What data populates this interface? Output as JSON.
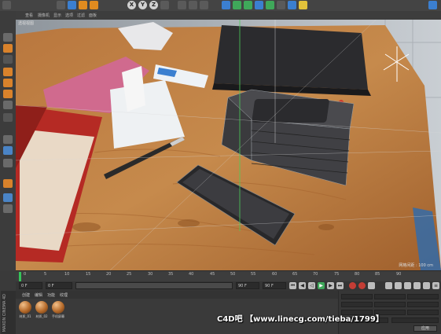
{
  "toolbar": {
    "axis_buttons": [
      "X",
      "Y",
      "Z"
    ]
  },
  "viewport": {
    "menu": [
      "查看",
      "摄像机",
      "显示",
      "选项",
      "过滤",
      "面板"
    ],
    "label": "透视视图",
    "scale": "网格间距 : 100 cm"
  },
  "timeline": {
    "ticks": [
      "0",
      "5",
      "10",
      "15",
      "20",
      "25",
      "30",
      "35",
      "40",
      "45",
      "50",
      "55",
      "60",
      "65",
      "70",
      "75",
      "80",
      "85",
      "90"
    ]
  },
  "transport": {
    "start_frame": "0 F",
    "end_frame": "90 F",
    "min_frame": "0 F",
    "max_frame": "90 F"
  },
  "material_manager": {
    "menu": [
      "创建",
      "编辑",
      "功能",
      "纹理"
    ],
    "materials": [
      "材质_01",
      "材质_02",
      "手机屏幕"
    ]
  },
  "attributes": {
    "apply_label": "应用"
  },
  "brand": "MAXON CINEMA 4D",
  "watermark": "C4D吧 【www.linecg.com/tieba/1799】",
  "colors": {
    "accent_orange": "#e08b1f",
    "playhead_green": "#36c45a",
    "record_red": "#c43d35"
  }
}
